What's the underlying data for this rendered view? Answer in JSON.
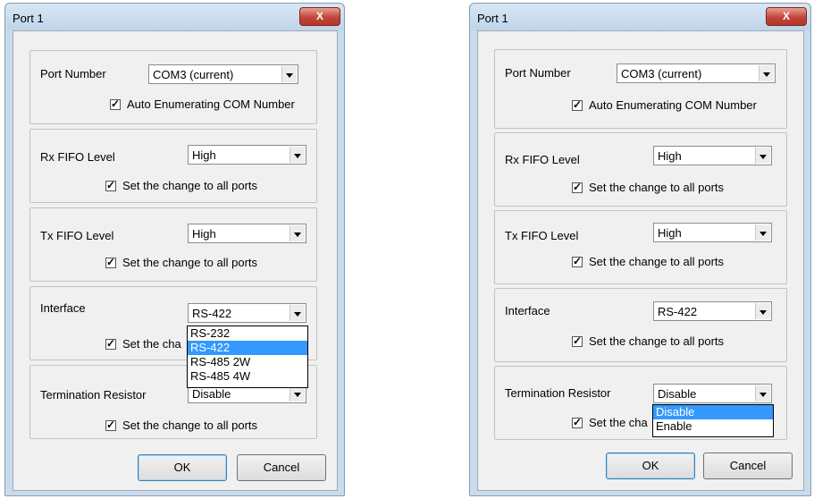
{
  "colors": {
    "selection": "#3399ff",
    "close_button": "#c2453a",
    "dialog_frame": "#c9dcee"
  },
  "left_dialog": {
    "title": "Port 1",
    "close_glyph": "X",
    "port_number": {
      "label": "Port Number",
      "value": "COM3 (current)",
      "auto_enum_label": "Auto Enumerating COM Number"
    },
    "rx_fifo": {
      "label": "Rx FIFO Level",
      "value": "High",
      "apply_all_label": "Set the change to all ports"
    },
    "tx_fifo": {
      "label": "Tx FIFO Level",
      "value": "High",
      "apply_all_label": "Set the change to all ports"
    },
    "interface": {
      "label": "Interface",
      "value": "RS-422",
      "apply_all_label_partial": "Set the cha",
      "options": [
        "RS-232",
        "RS-422",
        "RS-485 2W",
        "RS-485 4W"
      ],
      "selected_option": "RS-422"
    },
    "termination": {
      "label": "Termination Resistor",
      "value": "Disable",
      "apply_all_label": "Set the change to all ports"
    },
    "ok_label": "OK",
    "cancel_label": "Cancel"
  },
  "right_dialog": {
    "title": "Port 1",
    "close_glyph": "X",
    "port_number": {
      "label": "Port Number",
      "value": "COM3 (current)",
      "auto_enum_label": "Auto Enumerating COM Number"
    },
    "rx_fifo": {
      "label": "Rx FIFO Level",
      "value": "High",
      "apply_all_label": "Set the change to all ports"
    },
    "tx_fifo": {
      "label": "Tx FIFO Level",
      "value": "High",
      "apply_all_label": "Set the change to all ports"
    },
    "interface": {
      "label": "Interface",
      "value": "RS-422",
      "apply_all_label": "Set the change to all ports"
    },
    "termination": {
      "label": "Termination Resistor",
      "value": "Disable",
      "apply_all_label_partial": "Set the cha",
      "options": [
        "Disable",
        "Enable"
      ],
      "selected_option": "Disable"
    },
    "ok_label": "OK",
    "cancel_label": "Cancel"
  }
}
